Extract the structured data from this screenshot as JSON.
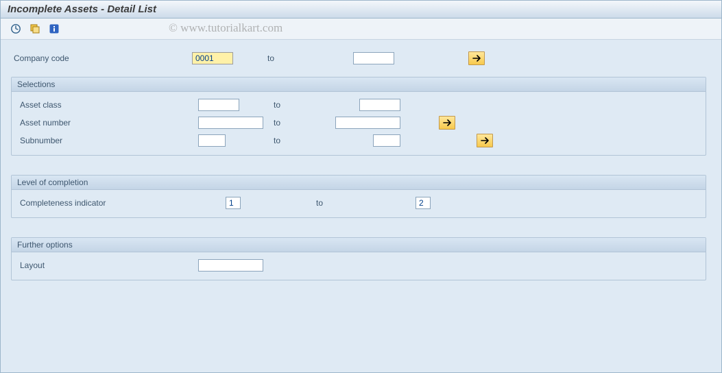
{
  "header": {
    "title": "Incomplete Assets - Detail List"
  },
  "toolbar": {
    "icons": {
      "execute": "execute-icon",
      "variant": "variant-icon",
      "info": "info-icon"
    }
  },
  "watermark": "© www.tutorialkart.com",
  "top_row": {
    "company_code": {
      "label": "Company code",
      "from": "0001",
      "to_label": "to",
      "to": "",
      "has_multi": true
    }
  },
  "groups": [
    {
      "title": "Selections",
      "rows": [
        {
          "id": "asset_class",
          "label": "Asset class",
          "from": "",
          "to_label": "to",
          "to": "",
          "from_w": "md",
          "to_w": "md",
          "has_multi": false
        },
        {
          "id": "asset_number",
          "label": "Asset number",
          "from": "",
          "to_label": "to",
          "to": "",
          "from_w": "lg",
          "to_w": "lg",
          "has_multi": true
        },
        {
          "id": "subnumber",
          "label": "Subnumber",
          "from": "",
          "to_label": "to",
          "to": "",
          "from_w": "sm",
          "to_w": "sm",
          "has_multi": true
        }
      ]
    },
    {
      "title": "Level of completion",
      "rows": [
        {
          "id": "completeness",
          "label": "Completeness indicator",
          "from": "1",
          "to_label": "to",
          "to": "2",
          "from_w": "sm",
          "to_w": "sm_shift",
          "has_multi": false
        }
      ]
    },
    {
      "title": "Further options",
      "rows": [
        {
          "id": "layout",
          "label": "Layout",
          "from": "",
          "from_w": "lg",
          "single": true
        }
      ]
    }
  ]
}
